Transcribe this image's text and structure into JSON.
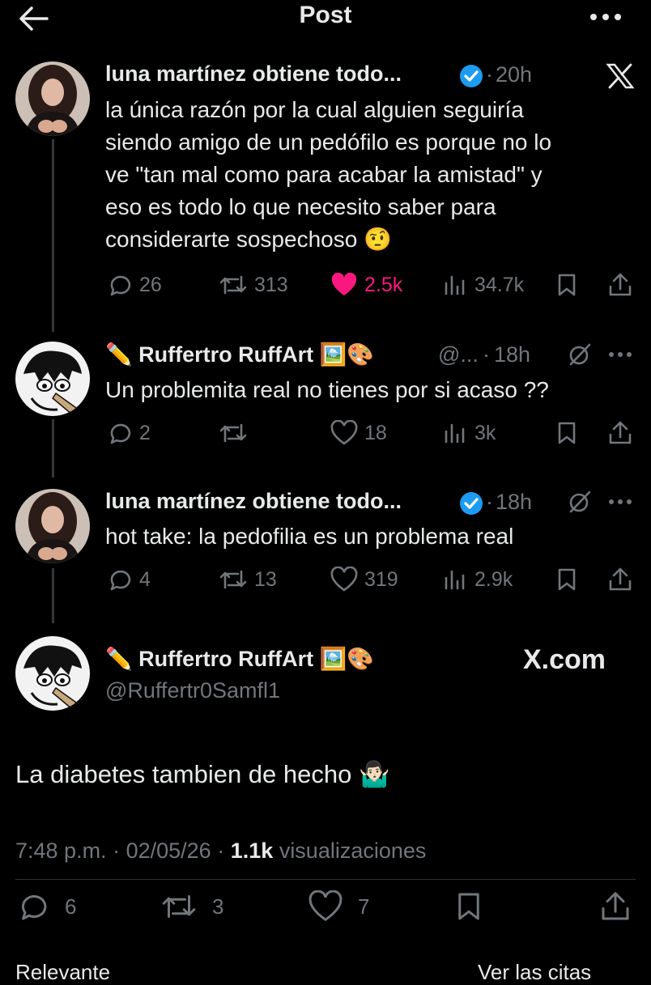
{
  "header": {
    "title": "Post"
  },
  "tweet1": {
    "name": "luna martínez obtiene todo...",
    "dot": "·",
    "time": "20h",
    "lines": [
      "la única razón por la cual alguien seguiría",
      "siendo amigo de un pedófilo es porque no lo",
      "ve \"tan mal como para acabar la amistad\" y",
      "eso es todo lo que necesito saber para",
      "considerarte sospechoso"
    ],
    "emoji": "🤨",
    "replies": "26",
    "reposts": "313",
    "likes": "2.5k",
    "views": "34.7k"
  },
  "tweet2": {
    "pencil": "✏️",
    "name": "Ruffertro RuffArt",
    "emojis": "🖼️🎨",
    "handle": "@...",
    "dot": "·",
    "time": "18h",
    "text": "Un problemita real no tienes por si acaso ??",
    "replies": "2",
    "likes": "18",
    "views": "3k"
  },
  "tweet3": {
    "name": "luna martínez obtiene todo...",
    "dot": "·",
    "time": "18h",
    "text": "hot take: la pedofilia es un problema real",
    "replies": "4",
    "reposts": "13",
    "likes": "319",
    "views": "2.9k"
  },
  "main": {
    "pencil": "✏️",
    "name": "Ruffertro RuffArt",
    "emojis": "🖼️🎨",
    "handle": "@Ruffertr0Samfl1",
    "watermark": "X.com",
    "text": "La diabetes tambien de hecho",
    "emoji": "🤷🏻‍♂️",
    "time": "7:48 p.m.",
    "dot1": "·",
    "date": "02/05/26",
    "dot2": "·",
    "views_count": "1.1k",
    "views_label": "visualizaciones",
    "replies": "6",
    "reposts": "3",
    "likes": "7"
  },
  "footer": {
    "left": "Relevante",
    "right": "Ver las citas"
  },
  "colors": {
    "accent_pink": "#f91880",
    "verified_blue": "#1d9bf0",
    "muted": "#71767b",
    "line": "#333639"
  }
}
